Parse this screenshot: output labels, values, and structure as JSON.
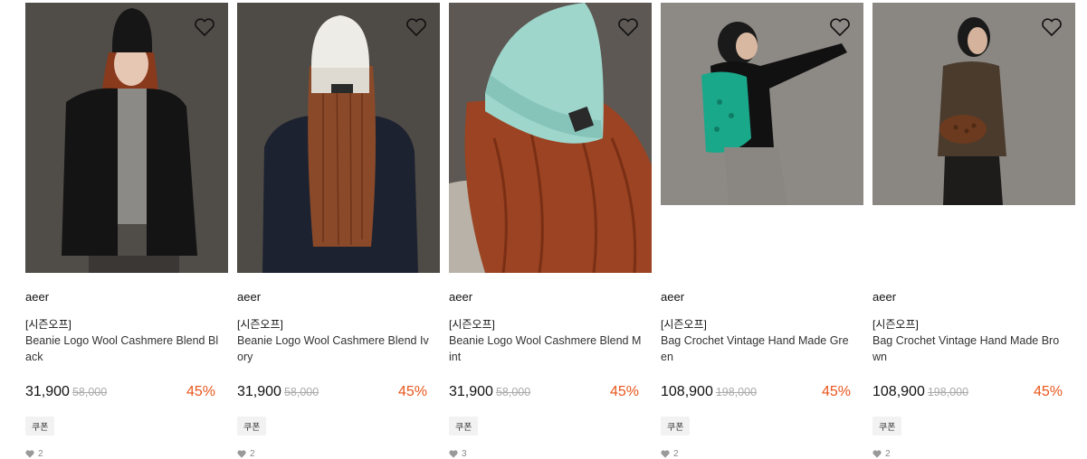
{
  "products": [
    {
      "brand": "aeer",
      "tag": "[시즌오프]",
      "name": "Beanie Logo Wool Cashmere Blend Black",
      "price": "31,900",
      "original_price": "58,000",
      "discount": "45%",
      "coupon": "쿠폰",
      "likes": "2",
      "image": {
        "bg": "#5a5550",
        "accent": "#1a1a1a",
        "hat": "#1a1a1a",
        "hair": "#8a3a1c"
      }
    },
    {
      "brand": "aeer",
      "tag": "[시즌오프]",
      "name": "Beanie Logo Wool Cashmere Blend Ivory",
      "price": "31,900",
      "original_price": "58,000",
      "discount": "45%",
      "coupon": "쿠폰",
      "likes": "2",
      "image": {
        "bg": "#4e4a45",
        "accent": "#1d2230",
        "hat": "#eeece6",
        "hair": "#8a4a2a"
      }
    },
    {
      "brand": "aeer",
      "tag": "[시즌오프]",
      "name": "Beanie Logo Wool Cashmere Blend Mint",
      "price": "31,900",
      "original_price": "58,000",
      "discount": "45%",
      "coupon": "쿠폰",
      "likes": "3",
      "image": {
        "bg": "#5d5853",
        "accent": "#b8b2a8",
        "hat": "#9ed6cc",
        "hair": "#9b4322"
      }
    },
    {
      "brand": "aeer",
      "tag": "[시즌오프]",
      "name": "Bag Crochet Vintage Hand Made Green",
      "price": "108,900",
      "original_price": "198,000",
      "discount": "45%",
      "coupon": "쿠폰",
      "likes": "2",
      "image": {
        "bg": "#8d8985",
        "accent": "#111111",
        "hat": "#1aa88a",
        "hair": "#1a1a1a"
      }
    },
    {
      "brand": "aeer",
      "tag": "[시즌오프]",
      "name": "Bag Crochet Vintage Hand Made Brown",
      "price": "108,900",
      "original_price": "198,000",
      "discount": "45%",
      "coupon": "쿠폰",
      "likes": "2",
      "image": {
        "bg": "#8a8682",
        "accent": "#4a3b2d",
        "hat": "#6b3a1f",
        "hair": "#1a1a1a"
      }
    }
  ],
  "colors": {
    "discount": "#e8551c",
    "strike_price": "#aaaaaa",
    "coupon_bg": "#f2f2f2"
  }
}
